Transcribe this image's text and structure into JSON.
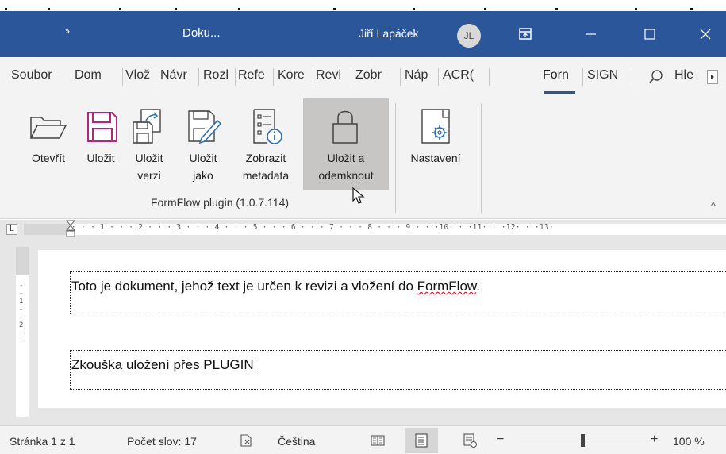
{
  "titlebar": {
    "qat_glyph": "››",
    "doc_title": "Doku...",
    "user_name": "Jiří Lapáček",
    "user_initials": "JL",
    "minimize": "—",
    "maximize": "☐",
    "close": "✕",
    "color": "#2b579a"
  },
  "tabs": [
    "Soubor",
    "Dom",
    "Vlož",
    "Návr",
    "Rozl",
    "Refe",
    "Kore",
    "Revi",
    "Zobr",
    "Náp",
    "ACR(",
    "Forn",
    "SIGN"
  ],
  "active_tab": "Forn",
  "tell_me": "Hle",
  "ribbon": {
    "buttons": [
      {
        "label": "Otevřít",
        "icon": "open-folder-icon"
      },
      {
        "label": "Uložit",
        "icon": "save-icon"
      },
      {
        "label": "Uložit\nverzi",
        "icon": "save-version-icon"
      },
      {
        "label": "Uložit\njako",
        "icon": "save-as-icon"
      },
      {
        "label": "Zobrazit\nmetadata",
        "icon": "metadata-icon"
      },
      {
        "label": "Uložit a\nodemknout",
        "icon": "unlock-icon"
      },
      {
        "label": "Nastavení",
        "icon": "settings-document-icon"
      }
    ],
    "group_label": "FormFlow plugin (1.0.7.114)",
    "collapse_glyph": "^",
    "save_color": "#b4267a"
  },
  "ruler": {
    "tab_selector": "L",
    "marks": "· · · 1 · · · 2 · · · 3 · · · 4 · · · 5 · · · 6 · · · 7 · · · 8 · · · 9 · · ·10· · ·11· · ·12· · ·13·",
    "vmarks": "- - 1 - - 2 - -"
  },
  "document": {
    "line1_pre": "Toto je dokument, jehož text je určen k revizi a vložení do ",
    "line1_misspelled": "FormFlow",
    "line1_post": ".",
    "line2": "Zkouška uložení přes PLUGIN"
  },
  "statusbar": {
    "page": "Stránka 1 z 1",
    "words": "Počet slov: 17",
    "language": "Čeština",
    "zoom_minus": "−",
    "zoom_plus": "+",
    "zoom_level": "100 %",
    "zoom_fraction": 0.5
  }
}
